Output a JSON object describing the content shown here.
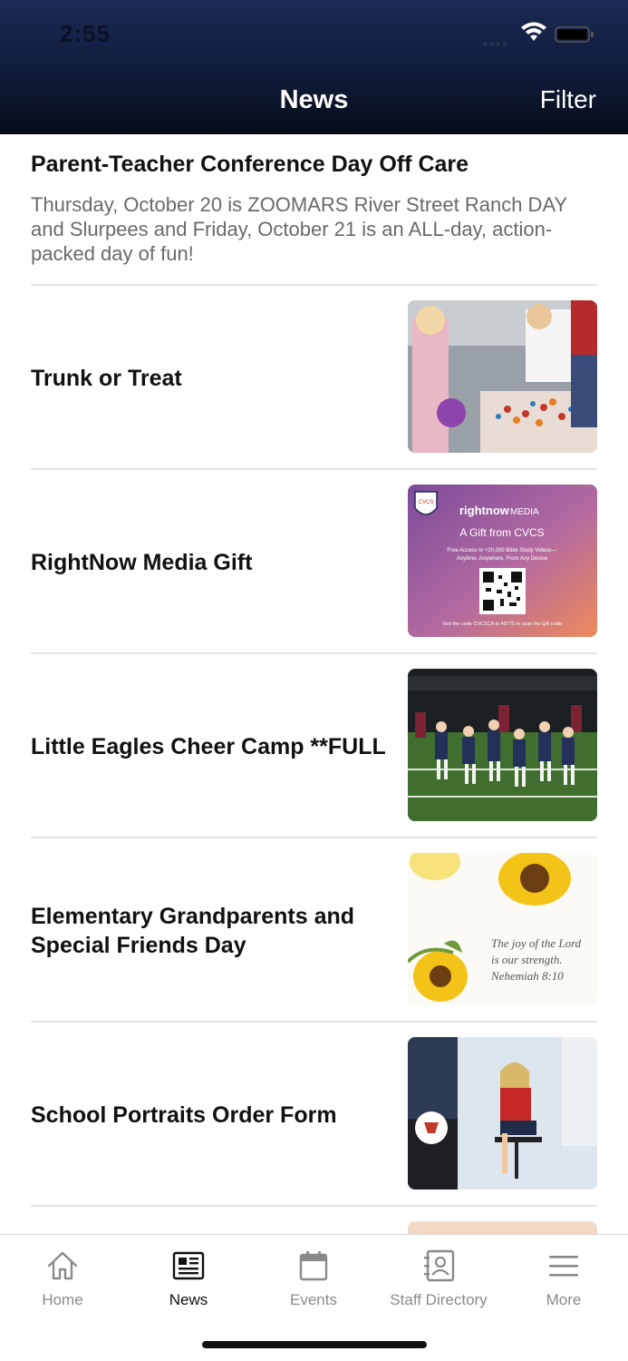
{
  "status_bar": {
    "time": "2:55"
  },
  "nav": {
    "title": "News",
    "filter_label": "Filter"
  },
  "featured": {
    "title": "Parent-Teacher Conference Day Off Care",
    "body": "Thursday, October 20 is ZOOMARS River Street Ranch DAY and Slurpees and Friday, October 21 is an ALL-day, action-packed day of fun!"
  },
  "news_items": [
    {
      "title": "Trunk or Treat"
    },
    {
      "title": "RightNow Media Gift",
      "thumb_text": {
        "badge": "CVCS",
        "brand": "rightnow",
        "brand_suffix": "MEDIA",
        "headline": "A Gift from CVCS",
        "line1": "Free Access to +20,000 Bible Study Videos—",
        "line2": "Anytime, Anywhere, From Any Device",
        "footer": "Text the code CVCSCA to 49775 or scan the QR code"
      }
    },
    {
      "title": "Little Eagles Cheer Camp **FULL"
    },
    {
      "title": "Elementary Grandparents and Special Friends Day",
      "thumb_text": {
        "verse1": "The joy of the Lord",
        "verse2": "is our strength.",
        "ref": "Nehemiah 8:10"
      }
    },
    {
      "title": "School Portraits Order Form"
    }
  ],
  "tabbar": {
    "tabs": [
      {
        "label": "Home",
        "icon": "home-icon"
      },
      {
        "label": "News",
        "icon": "newspaper-icon"
      },
      {
        "label": "Events",
        "icon": "calendar-icon"
      },
      {
        "label": "Staff Directory",
        "icon": "contact-card-icon"
      },
      {
        "label": "More",
        "icon": "hamburger-icon"
      }
    ],
    "active": "News"
  },
  "colors": {
    "header_top": "#1b2a55",
    "header_bottom": "#060b18",
    "divider": "#e3e3e3",
    "tab_inactive": "#8a8a8a"
  }
}
